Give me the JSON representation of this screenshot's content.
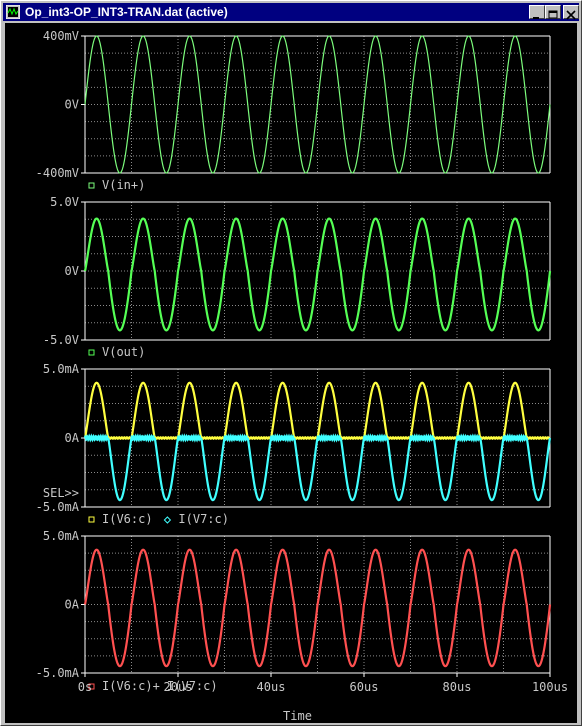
{
  "window": {
    "title": "Op_int3-OP_INT3-TRAN.dat (active)"
  },
  "theme": {
    "background": "#000000",
    "axis_color": "#ffffff",
    "grid_color": "#8a8a8a",
    "label_color": "#c8c8c8"
  },
  "chart_data": [
    {
      "type": "line",
      "ylim": [
        -400,
        400
      ],
      "yunit": "mV",
      "ytick_labels": [
        "400mV",
        "0V",
        "-400mV"
      ],
      "legend": [
        "V(in+)"
      ],
      "series": [
        {
          "name": "V(in+)",
          "color": "#7cfc7c",
          "cycles": 10,
          "amplitude": 400,
          "shape": "sine"
        }
      ]
    },
    {
      "type": "line",
      "ylim": [
        -5,
        5
      ],
      "yunit": "V",
      "ytick_labels": [
        "5.0V",
        "0V",
        "-5.0V"
      ],
      "legend": [
        "V(out)"
      ],
      "series": [
        {
          "name": "V(out)",
          "color": "#55ff55",
          "cycles": 10,
          "pos_peak": 3.8,
          "neg_peak": -4.3,
          "shape": "distorted"
        }
      ]
    },
    {
      "type": "line",
      "ylim": [
        -5,
        5
      ],
      "yunit": "mA",
      "ytick_labels": [
        "5.0mA",
        "0A",
        "-5.0mA"
      ],
      "selected_marker": "SEL>>",
      "legend": [
        "I(V6:c)",
        "I(V7:c)"
      ],
      "series": [
        {
          "name": "I(V6:c)",
          "color": "#ffff40",
          "cycles": 10,
          "pos_peak": 4.0,
          "shape": "half-positive"
        },
        {
          "name": "I(V7:c)",
          "color": "#40ffff",
          "cycles": 10,
          "neg_peak": -4.5,
          "shape": "half-negative"
        }
      ]
    },
    {
      "type": "line",
      "ylim": [
        -5,
        5
      ],
      "yunit": "mA",
      "ytick_labels": [
        "5.0mA",
        "0A",
        "-5.0mA"
      ],
      "legend": [
        "I(V6:c)+ I(V7:c)"
      ],
      "series": [
        {
          "name": "I(V6:c)+ I(V7:c)",
          "color": "#ff5050",
          "cycles": 10,
          "pos_peak": 4.0,
          "neg_peak": -4.5,
          "shape": "distorted"
        }
      ]
    }
  ],
  "x_axis": {
    "xlim": [
      0,
      100
    ],
    "unit": "us",
    "tick_labels": [
      "0s",
      "20us",
      "40us",
      "60us",
      "80us",
      "100us"
    ],
    "xlabel": "Time"
  }
}
